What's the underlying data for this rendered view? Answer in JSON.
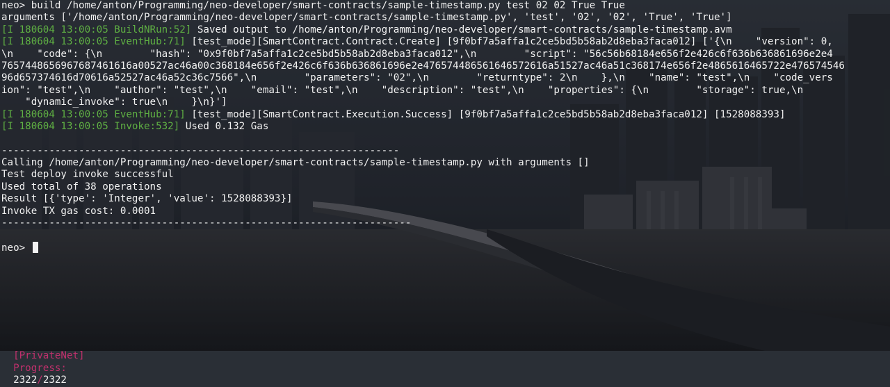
{
  "terminal": {
    "lines": [
      {
        "segments": [
          {
            "text": "neo> build /home/anton/Programming/neo-developer/smart-contracts/sample-timestamp.py test 02 02 True True",
            "color": "white"
          }
        ]
      },
      {
        "segments": [
          {
            "text": "arguments ['/home/anton/Programming/neo-developer/smart-contracts/sample-timestamp.py', 'test', '02', '02', 'True', 'True']",
            "color": "white"
          }
        ]
      },
      {
        "segments": [
          {
            "text": "[I 180604 13:00:05 BuildNRun:52]",
            "color": "green"
          },
          {
            "text": " Saved output to /home/anton/Programming/neo-developer/smart-contracts/sample-timestamp.avm",
            "color": "white"
          }
        ]
      },
      {
        "segments": [
          {
            "text": "[I 180604 13:00:05 EventHub:71]",
            "color": "green"
          },
          {
            "text": " [test_mode][SmartContract.Contract.Create] [9f0bf7a5affa1c2ce5bd5b58ab2d8eba3faca012] ['{\\n    \"version\": 0,",
            "color": "white"
          }
        ]
      },
      {
        "segments": [
          {
            "text": "\\n    \"code\": {\\n        \"hash\": \"0x9f0bf7a5affa1c2ce5bd5b58ab2d8eba3faca012\",\\n        \"script\": \"56c56b68184e656f2e426c6f636b636861696e2e4",
            "color": "white"
          }
        ]
      },
      {
        "segments": [
          {
            "text": "7657448656967687461616a00527ac46a00c368184e656f2e426c6f636b636861696e2e476574486561646572616a51527ac46a51c368174e656f2e4865616465722e476574546",
            "color": "white"
          }
        ]
      },
      {
        "segments": [
          {
            "text": "96d657374616d70616a52527ac46a52c36c7566\",\\n        \"parameters\": \"02\",\\n        \"returntype\": 2\\n    },\\n    \"name\": \"test\",\\n    \"code_vers",
            "color": "white"
          }
        ]
      },
      {
        "segments": [
          {
            "text": "ion\": \"test\",\\n    \"author\": \"test\",\\n    \"email\": \"test\",\\n    \"description\": \"test\",\\n    \"properties\": {\\n        \"storage\": true,\\n",
            "color": "white"
          }
        ]
      },
      {
        "segments": [
          {
            "text": "    \"dynamic_invoke\": true\\n    }\\n}']",
            "color": "white"
          }
        ]
      },
      {
        "segments": [
          {
            "text": "[I 180604 13:00:05 EventHub:71]",
            "color": "green"
          },
          {
            "text": " [test_mode][SmartContract.Execution.Success] [9f0bf7a5affa1c2ce5bd5b58ab2d8eba3faca012] [1528088393]",
            "color": "white"
          }
        ]
      },
      {
        "segments": [
          {
            "text": "[I 180604 13:00:05 Invoke:532]",
            "color": "green"
          },
          {
            "text": " Used 0.132 Gas",
            "color": "white"
          }
        ]
      },
      {
        "segments": [
          {
            "text": "",
            "color": "white"
          }
        ]
      },
      {
        "segments": [
          {
            "text": "-------------------------------------------------------------------",
            "color": "white"
          }
        ]
      },
      {
        "segments": [
          {
            "text": "Calling /home/anton/Programming/neo-developer/smart-contracts/sample-timestamp.py with arguments []",
            "color": "white"
          }
        ]
      },
      {
        "segments": [
          {
            "text": "Test deploy invoke successful",
            "color": "white"
          }
        ]
      },
      {
        "segments": [
          {
            "text": "Used total of 38 operations",
            "color": "white"
          }
        ]
      },
      {
        "segments": [
          {
            "text": "Result [{'type': 'Integer', 'value': 1528088393}]",
            "color": "white"
          }
        ]
      },
      {
        "segments": [
          {
            "text": "Invoke TX gas cost: 0.0001",
            "color": "white"
          }
        ]
      },
      {
        "segments": [
          {
            "text": "---------------------------------------------------------------------",
            "color": "white"
          }
        ]
      },
      {
        "segments": [
          {
            "text": "",
            "color": "white"
          }
        ]
      },
      {
        "segments": [
          {
            "text": "neo> ",
            "color": "white"
          }
        ]
      }
    ]
  },
  "status_bar": {
    "network_tag": "[PrivateNet]",
    "progress_label": "Progress:",
    "progress_current": "2322",
    "progress_separator": "/",
    "progress_total": "2322"
  },
  "colors": {
    "green": "#5fb043",
    "magenta": "#c0306c",
    "text": "#e6e6e6"
  }
}
